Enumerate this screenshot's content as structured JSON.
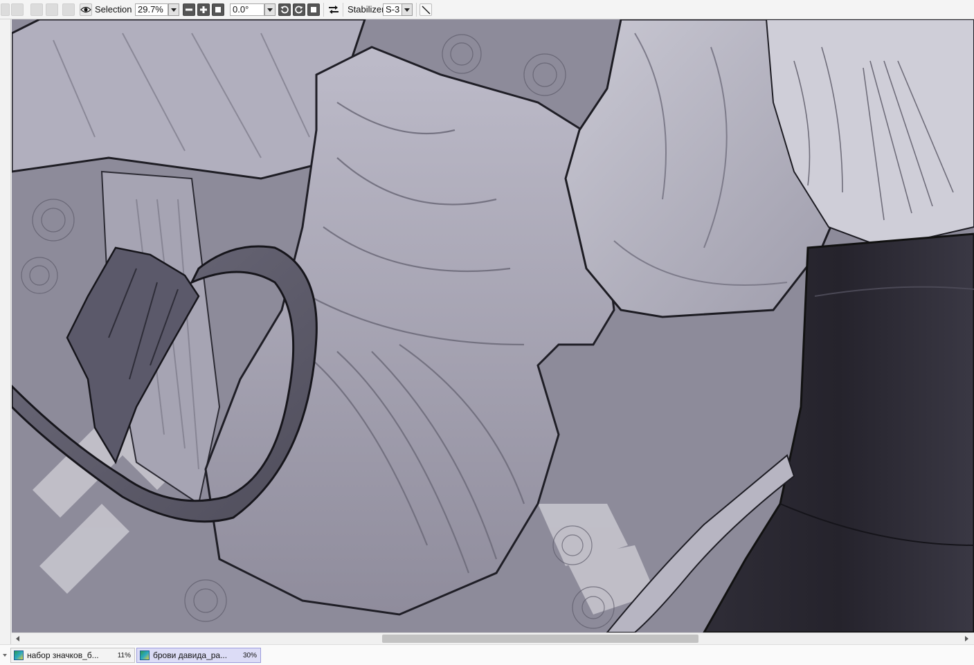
{
  "toolbar": {
    "selection_label": "Selection",
    "zoom_value": "29.7%",
    "rotation_value": "0.0°",
    "stabilizer_label": "Stabilizer",
    "stabilizer_value": "S-3"
  },
  "icons": {
    "undo": "undo-icon",
    "redo": "redo-icon",
    "eye": "eye-icon",
    "zoom_out": "minus-icon",
    "zoom_in": "plus-icon",
    "zoom_reset": "square-icon",
    "rotate_ccw": "rotate-left-icon",
    "rotate_cw": "rotate-right-icon",
    "rotate_reset": "square-icon",
    "flip": "flip-horizontal-icon",
    "line": "straight-line-icon"
  },
  "tabs": [
    {
      "name": "набор значков_б...",
      "zoom": "11%",
      "active": false
    },
    {
      "name": "брови давида_ра...",
      "zoom": "30%",
      "active": true
    }
  ],
  "scrollbar": {
    "horizontal_position": 0.55
  },
  "colors": {
    "active_tab": "#dcdcf6",
    "canvas_tone": "#8f8d9c"
  }
}
